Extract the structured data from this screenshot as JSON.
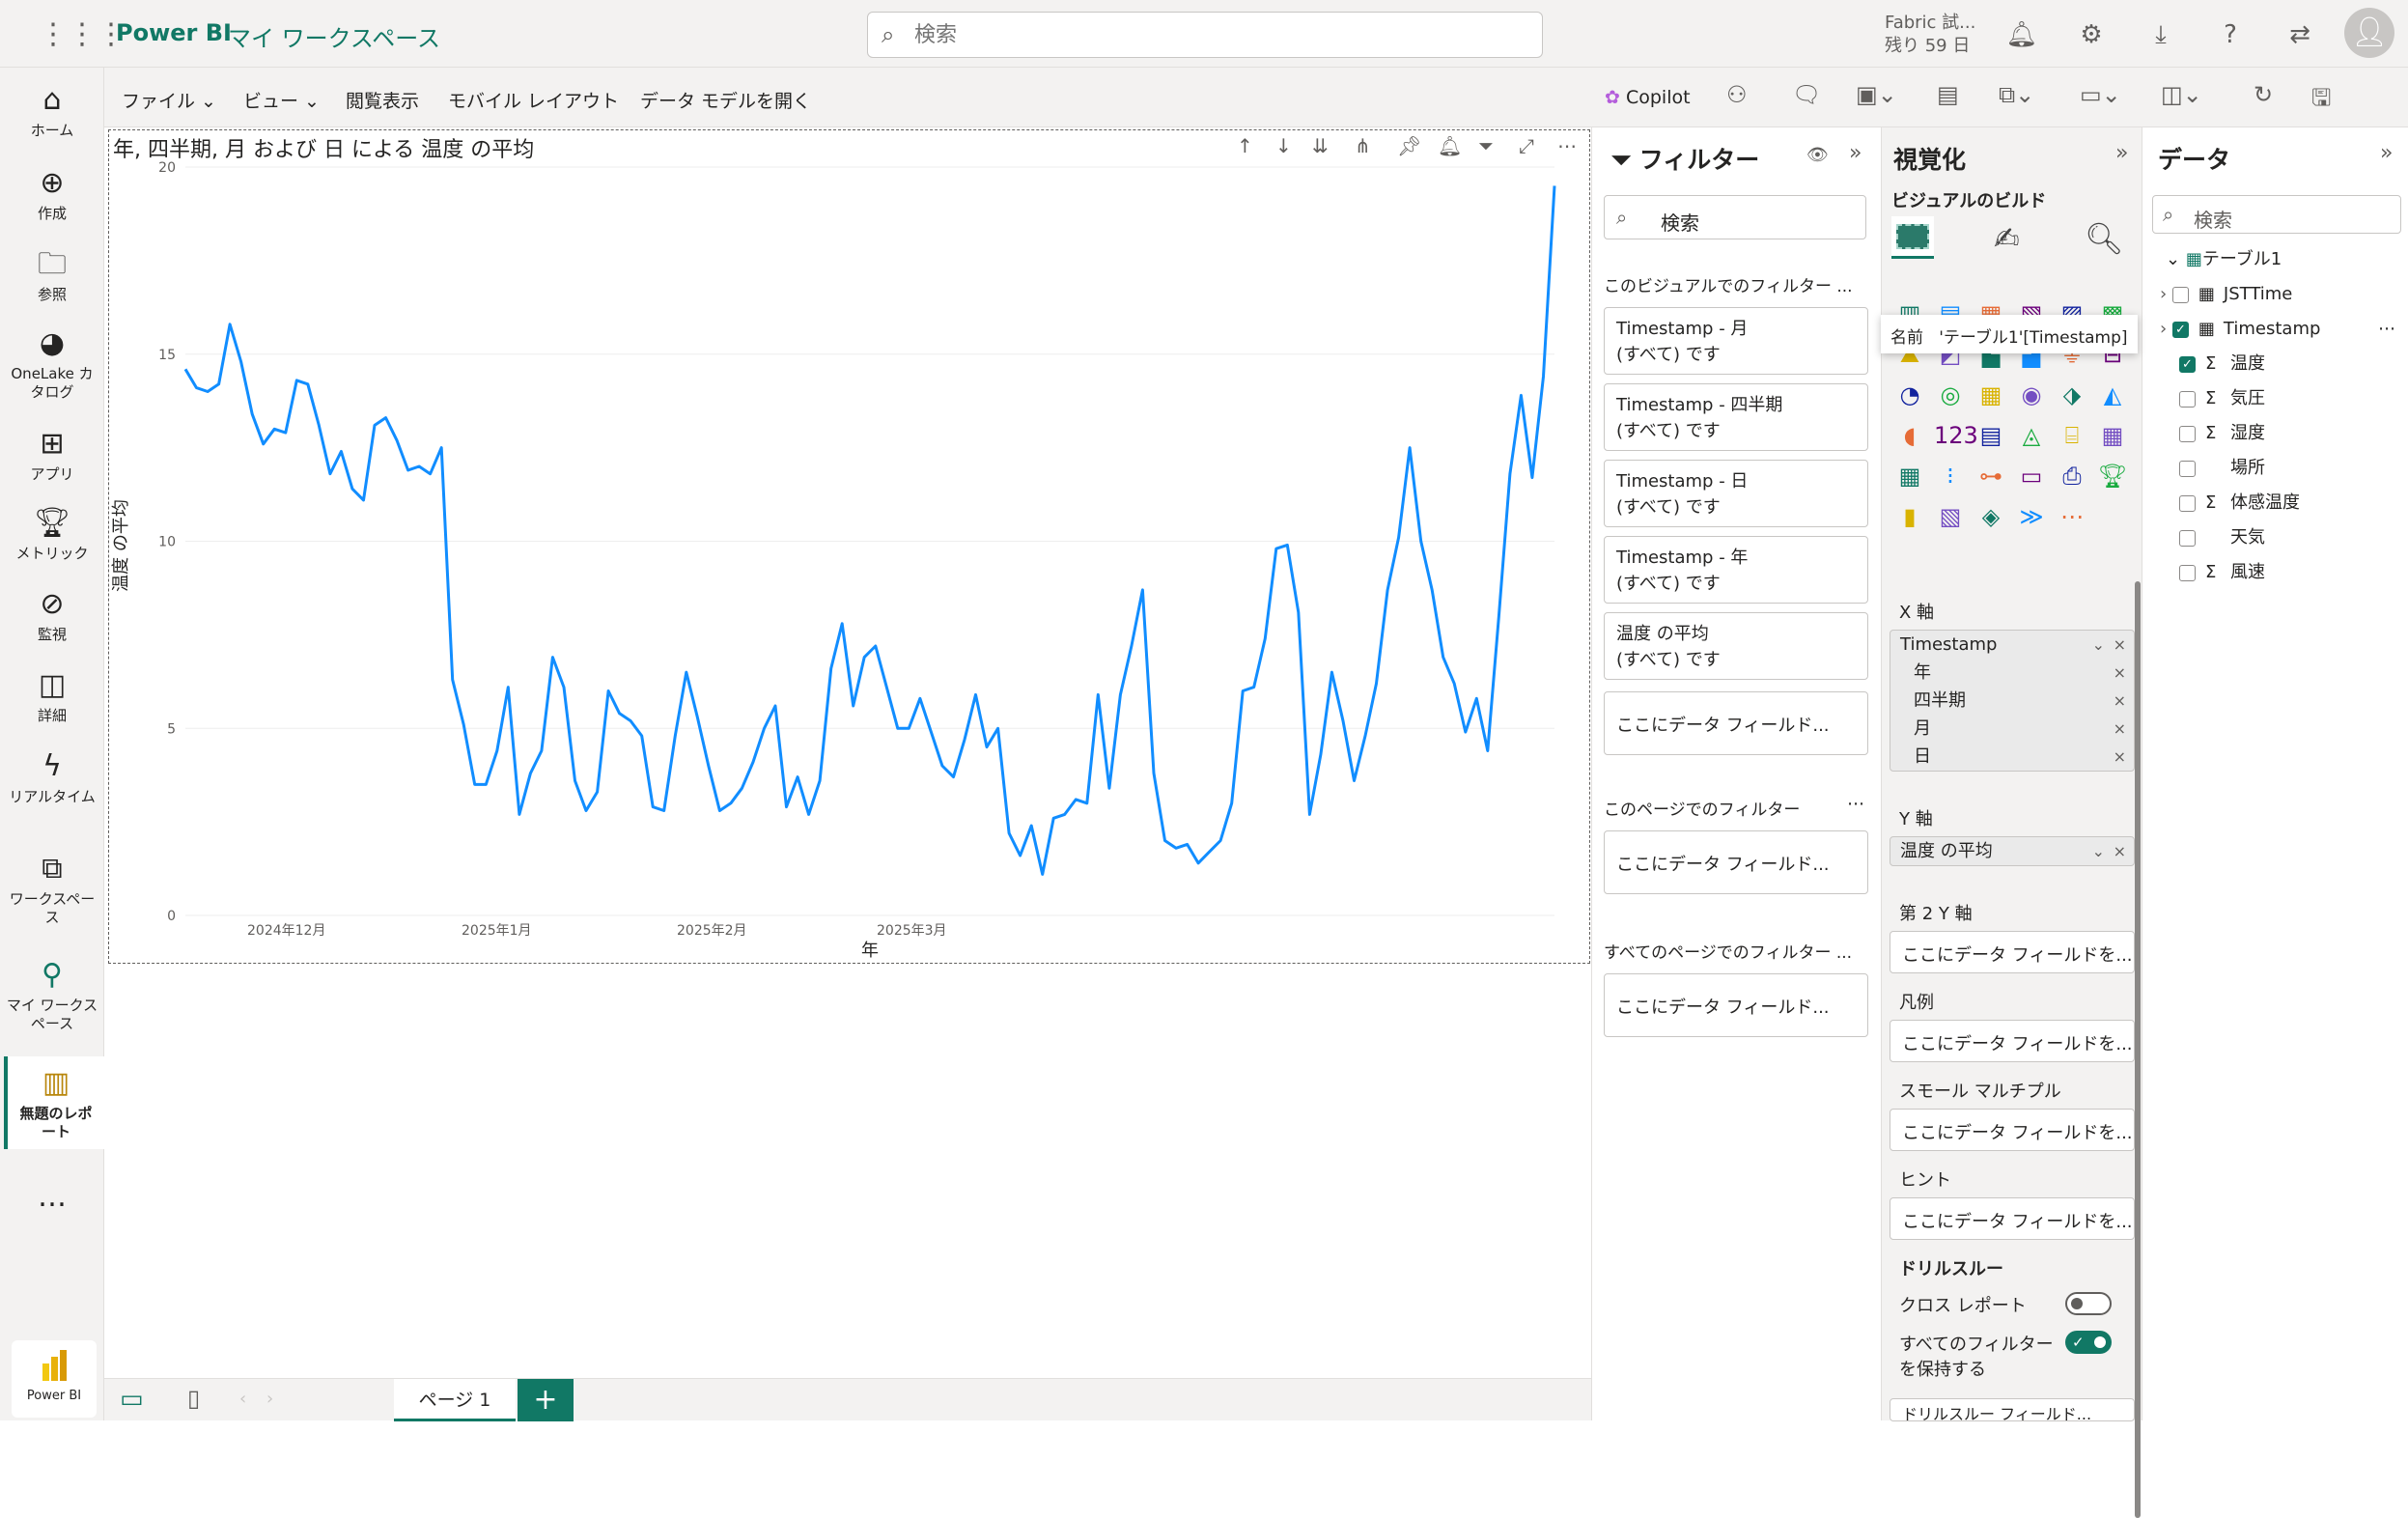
{
  "topbar": {
    "brand": "Power BI",
    "workspace": "マイ ワークスペース",
    "search_placeholder": "検索",
    "trial_line1": "Fabric 試...",
    "trial_line2": "残り 59 日"
  },
  "nav": [
    {
      "label": "ホーム",
      "icon": "home-icon"
    },
    {
      "label": "作成",
      "icon": "plus-circle-icon"
    },
    {
      "label": "参照",
      "icon": "folder-icon"
    },
    {
      "label": "OneLake カタログ",
      "icon": "onelake-icon"
    },
    {
      "label": "アプリ",
      "icon": "apps-icon"
    },
    {
      "label": "メトリック",
      "icon": "trophy-icon"
    },
    {
      "label": "監視",
      "icon": "monitor-icon"
    },
    {
      "label": "詳細",
      "icon": "book-icon"
    },
    {
      "label": "リアルタイム",
      "icon": "lightning-icon"
    },
    {
      "label": "ワークスペース",
      "icon": "workspaces-icon"
    },
    {
      "label": "マイ ワークスペース",
      "icon": "person-icon"
    },
    {
      "label": "無題のレポート",
      "icon": "report-icon"
    }
  ],
  "nav_more": "…",
  "nav_bottom": "Power BI",
  "ribbon": {
    "file": "ファイル",
    "view": "ビュー",
    "reading": "閲覧表示",
    "mobile": "モバイル レイアウト",
    "datamodel": "データ モデルを開く",
    "copilot": "Copilot"
  },
  "visual": {
    "title": "年, 四半期, 月 および 日 による 温度 の平均"
  },
  "chart_data": {
    "type": "line",
    "title": "年, 四半期, 月 および 日 による 温度 の平均",
    "xlabel": "年",
    "ylabel": "温度 の平均",
    "ylim": [
      0,
      20
    ],
    "yticks": [
      0,
      5,
      10,
      15,
      20
    ],
    "x_tick_labels": [
      "2024年12月",
      "2025年1月",
      "2025年2月",
      "2025年3月"
    ],
    "series": [
      {
        "name": "温度 の平均",
        "values": [
          14.6,
          14.1,
          14.0,
          14.2,
          15.8,
          14.8,
          13.4,
          12.6,
          13.0,
          12.9,
          14.3,
          14.2,
          13.1,
          11.8,
          12.4,
          11.4,
          11.1,
          13.1,
          13.3,
          12.7,
          11.9,
          12.0,
          11.8,
          12.5,
          6.3,
          5.1,
          3.5,
          3.5,
          4.4,
          6.1,
          2.7,
          3.8,
          4.4,
          6.9,
          6.1,
          3.6,
          2.8,
          3.3,
          6.0,
          5.4,
          5.2,
          4.8,
          2.9,
          2.8,
          4.8,
          6.5,
          5.3,
          4.0,
          2.8,
          3.0,
          3.4,
          4.1,
          5.0,
          5.6,
          2.9,
          3.7,
          2.7,
          3.6,
          6.6,
          7.8,
          5.6,
          6.9,
          7.2,
          6.1,
          5.0,
          5.0,
          5.8,
          4.9,
          4.0,
          3.7,
          4.7,
          5.9,
          4.5,
          5.0,
          2.2,
          1.6,
          2.4,
          1.1,
          2.6,
          2.7,
          3.1,
          3.0,
          5.9,
          3.4,
          5.9,
          7.2,
          8.7,
          3.8,
          2.0,
          1.8,
          1.9,
          1.4,
          1.7,
          2.0,
          3.0,
          6.0,
          6.1,
          7.4,
          9.8,
          9.9,
          8.1,
          2.7,
          4.3,
          6.5,
          5.2,
          3.6,
          4.8,
          6.2,
          8.7,
          10.1,
          12.5,
          10.0,
          8.7,
          6.9,
          6.2,
          4.9,
          5.8,
          4.4,
          8.0,
          11.8,
          13.9,
          11.7,
          14.4,
          19.5
        ]
      }
    ]
  },
  "pages": {
    "tab": "ページ 1",
    "add": "+"
  },
  "filters": {
    "title": "フィルター",
    "search": "検索",
    "visual_section": "このビジュアルでのフィルター ...",
    "cards": [
      [
        "Timestamp - 月",
        "(すべて) です"
      ],
      [
        "Timestamp - 四半期",
        "(すべて) です"
      ],
      [
        "Timestamp - 日",
        "(すべて) です"
      ],
      [
        "Timestamp - 年",
        "(すべて) です"
      ],
      [
        "温度 の平均",
        "(すべて) です"
      ]
    ],
    "drop": "ここにデータ フィールド...",
    "page_section": "このページでのフィルター",
    "all_section": "すべてのページでのフィルター ..."
  },
  "viz": {
    "title": "視覚化",
    "build": "ビジュアルのビルド",
    "tooltip_label": "名前",
    "tooltip_value": "'テーブル1'[Timestamp]",
    "xaxis": "X 軸",
    "xaxis_items": [
      "Timestamp",
      "年",
      "四半期",
      "月",
      "日"
    ],
    "yaxis": "Y 軸",
    "yaxis_item": "温度 の平均",
    "y2": "第 2 Y 軸",
    "legend": "凡例",
    "small": "スモール マルチプル",
    "hint": "ヒント",
    "drop": "ここにデータ フィールドを...",
    "drill": "ドリルスルー",
    "cross": "クロス レポート",
    "keep": "すべてのフィルター",
    "keep2": "を保持する",
    "drill_drop": "ドリルスルー フィールド..."
  },
  "data": {
    "title": "データ",
    "search": "検索",
    "table": "テーブル1",
    "fields": [
      {
        "name": "JSTTime",
        "checked": false,
        "icon": "calendar-icon"
      },
      {
        "name": "Timestamp",
        "checked": true,
        "icon": "calendar-icon"
      },
      {
        "name": "温度",
        "checked": true,
        "icon": "sigma-icon"
      },
      {
        "name": "気圧",
        "checked": false,
        "icon": "sigma-icon"
      },
      {
        "name": "湿度",
        "checked": false,
        "icon": "sigma-icon"
      },
      {
        "name": "場所",
        "checked": false,
        "icon": ""
      },
      {
        "name": "体感温度",
        "checked": false,
        "icon": "sigma-icon"
      },
      {
        "name": "天気",
        "checked": false,
        "icon": ""
      },
      {
        "name": "風速",
        "checked": false,
        "icon": "sigma-icon"
      }
    ]
  },
  "colors": {
    "accent": "#117865",
    "line": "#118DFF"
  }
}
